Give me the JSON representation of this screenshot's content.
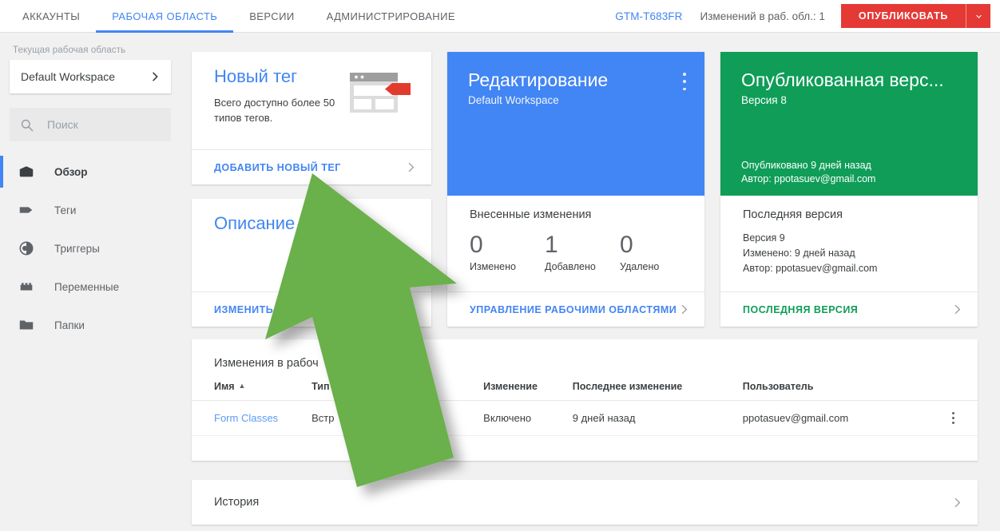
{
  "topbar": {
    "tabs": [
      {
        "label": "АККАУНТЫ",
        "active": false
      },
      {
        "label": "РАБОЧАЯ ОБЛАСТЬ",
        "active": true
      },
      {
        "label": "ВЕРСИИ",
        "active": false
      },
      {
        "label": "АДМИНИСТРИРОВАНИЕ",
        "active": false
      }
    ],
    "container_id": "GTM-T683FR",
    "changes_count_label": "Изменений в раб. обл.: 1",
    "publish_label": "ОПУБЛИКОВАТЬ",
    "publish_caret_icon": "chevron-down-icon",
    "accent_blue": "#4285f4",
    "publish_red": "#e53935"
  },
  "sidebar": {
    "workspace_label": "Текущая рабочая область",
    "workspace_value": "Default Workspace",
    "workspace_chevron_icon": "chevron-right-icon",
    "search_placeholder": "Поиск",
    "search_value": "",
    "search_icon": "search-icon",
    "items": [
      {
        "label": "Обзор",
        "icon": "overview-box-icon",
        "active": true
      },
      {
        "label": "Теги",
        "icon": "tag-icon",
        "active": false
      },
      {
        "label": "Триггеры",
        "icon": "trigger-circle-icon",
        "active": false
      },
      {
        "label": "Переменные",
        "icon": "variables-brick-icon",
        "active": false
      },
      {
        "label": "Папки",
        "icon": "folder-icon",
        "active": false
      }
    ]
  },
  "new_tag_card": {
    "title": "Новый тег",
    "subtitle": "Всего доступно более 50 типов тегов.",
    "image_icon": "browser-tag-illustration",
    "action_label": "ДОБАВИТЬ НОВЫЙ ТЕГ",
    "action_chevron_icon": "chevron-right-icon"
  },
  "description_card": {
    "title": "Описание",
    "action_label": "ИЗМЕНИТЬ О",
    "action_chevron_icon": "chevron-right-icon"
  },
  "editing_card": {
    "title": "Редактирование",
    "subtitle": "Default Workspace",
    "kebab_icon": "more-vert-icon",
    "changes_heading": "Внесенные изменения",
    "stats": [
      {
        "value": "0",
        "label": "Изменено"
      },
      {
        "value": "1",
        "label": "Добавлено"
      },
      {
        "value": "0",
        "label": "Удалено"
      }
    ],
    "action_label": "УПРАВЛЕНИЕ РАБОЧИМИ ОБЛАСТЯМИ",
    "action_chevron_icon": "chevron-right-icon",
    "hero_color": "#4285f4"
  },
  "published_card": {
    "title": "Опубликованная верс...",
    "subtitle": "Версия 8",
    "footer_line1": "Опубликовано 9 дней назад",
    "footer_line2": "Автор: ppotasuev@gmail.com",
    "latest_heading": "Последняя версия",
    "latest_line1": "Версия 9",
    "latest_line2": "Изменено: 9 дней назад",
    "latest_line3": "Автор: ppotasuev@gmail.com",
    "action_label": "ПОСЛЕДНЯЯ ВЕРСИЯ",
    "action_chevron_icon": "chevron-right-icon",
    "hero_color": "#0f9d58"
  },
  "changes_table": {
    "title": "Изменения в рабоч",
    "columns": [
      "Имя",
      "Тип",
      "Изменение",
      "Последнее изменение",
      "Пользователь",
      ""
    ],
    "sort_column": "Имя",
    "sort_direction": "ascending",
    "rows": [
      {
        "name": "Form Classes",
        "type": "Встр",
        "change": "Включено",
        "last_change": "9 дней назад",
        "user": "ppotasuev@gmail.com",
        "kebab_icon": "more-vert-icon"
      }
    ]
  },
  "history_card": {
    "label": "История",
    "chevron_icon": "chevron-right-icon"
  },
  "overlay": {
    "arrow_icon": "green-up-arrow-annotation",
    "arrow_color": "#6ab04c"
  }
}
